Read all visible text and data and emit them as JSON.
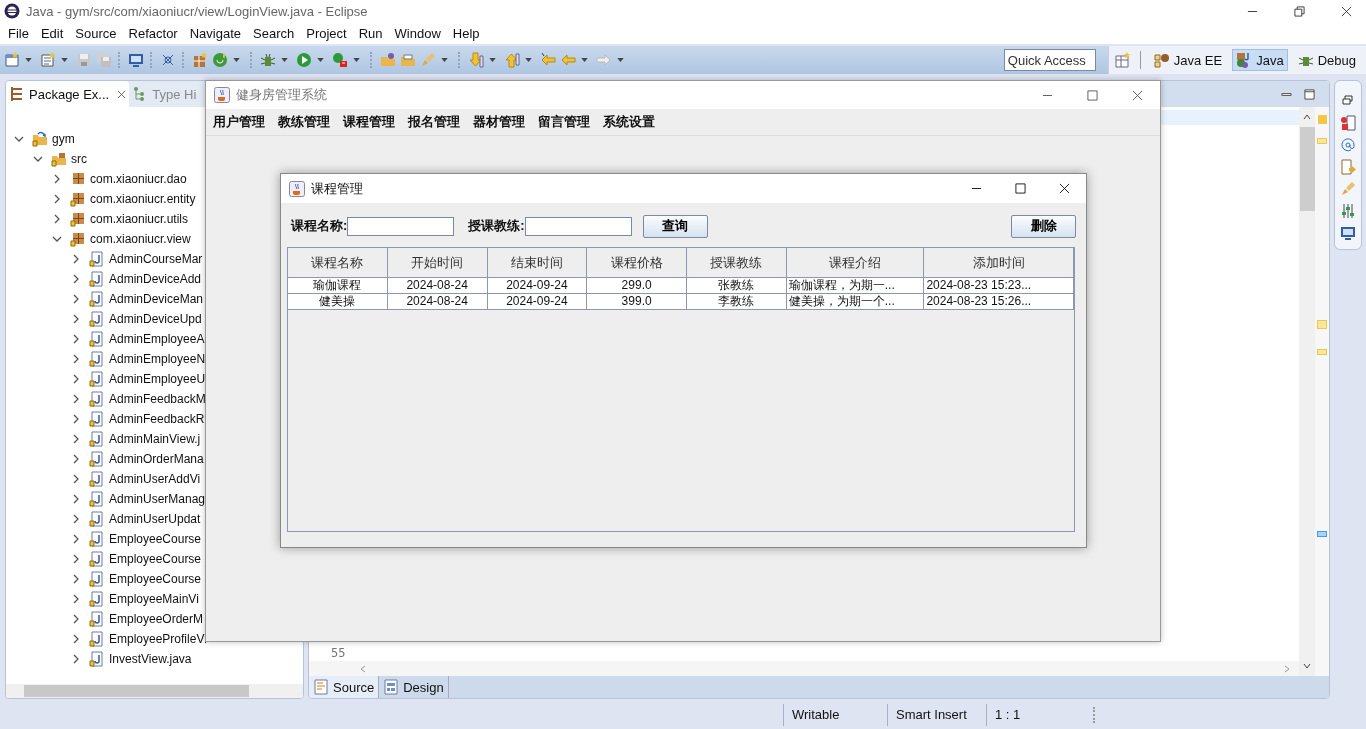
{
  "window": {
    "title": "Java - gym/src/com/xiaoniucr/view/LoginView.java - Eclipse"
  },
  "menu": [
    "File",
    "Edit",
    "Source",
    "Refactor",
    "Navigate",
    "Search",
    "Project",
    "Run",
    "Window",
    "Help"
  ],
  "quick_access": {
    "placeholder": "Quick Access"
  },
  "perspectives": [
    {
      "label": "Java EE",
      "selected": false
    },
    {
      "label": "Java",
      "selected": true
    },
    {
      "label": "Debug",
      "selected": false
    }
  ],
  "package_explorer": {
    "tabs": [
      {
        "label": "Package Ex...",
        "selected": true
      },
      {
        "label": "Type Hi",
        "selected": false
      }
    ],
    "tree": [
      {
        "label": "gym",
        "kind": "project",
        "expanded": true,
        "children": [
          {
            "label": "src",
            "kind": "folder",
            "expanded": true,
            "children": [
              {
                "label": "com.xiaoniucr.dao",
                "kind": "package",
                "expanded": false
              },
              {
                "label": "com.xiaoniucr.entity",
                "kind": "package",
                "expanded": false
              },
              {
                "label": "com.xiaoniucr.utils",
                "kind": "package",
                "expanded": false
              },
              {
                "label": "com.xiaoniucr.view",
                "kind": "package",
                "expanded": true,
                "children": [
                  {
                    "label": "AdminCourseMar",
                    "kind": "file",
                    "expanded": false
                  },
                  {
                    "label": "AdminDeviceAdd",
                    "kind": "file",
                    "expanded": false
                  },
                  {
                    "label": "AdminDeviceMan",
                    "kind": "file",
                    "expanded": false
                  },
                  {
                    "label": "AdminDeviceUpd",
                    "kind": "file",
                    "expanded": false
                  },
                  {
                    "label": "AdminEmployeeA",
                    "kind": "file",
                    "expanded": false
                  },
                  {
                    "label": "AdminEmployeeN",
                    "kind": "file",
                    "expanded": false
                  },
                  {
                    "label": "AdminEmployeeU",
                    "kind": "file",
                    "expanded": false
                  },
                  {
                    "label": "AdminFeedbackM",
                    "kind": "file",
                    "expanded": false
                  },
                  {
                    "label": "AdminFeedbackR",
                    "kind": "file",
                    "expanded": false
                  },
                  {
                    "label": "AdminMainView.j",
                    "kind": "file",
                    "expanded": false
                  },
                  {
                    "label": "AdminOrderMana",
                    "kind": "file",
                    "expanded": false
                  },
                  {
                    "label": "AdminUserAddVi",
                    "kind": "file",
                    "expanded": false
                  },
                  {
                    "label": "AdminUserManag",
                    "kind": "file",
                    "expanded": false
                  },
                  {
                    "label": "AdminUserUpdat",
                    "kind": "file",
                    "expanded": false
                  },
                  {
                    "label": "EmployeeCourse",
                    "kind": "file",
                    "expanded": false
                  },
                  {
                    "label": "EmployeeCourse",
                    "kind": "file",
                    "expanded": false
                  },
                  {
                    "label": "EmployeeCourse",
                    "kind": "file",
                    "expanded": false
                  },
                  {
                    "label": "EmployeeMainVi",
                    "kind": "file",
                    "expanded": false
                  },
                  {
                    "label": "EmployeeOrderM",
                    "kind": "file",
                    "expanded": false
                  },
                  {
                    "label": "EmployeeProfileVi",
                    "kind": "file",
                    "expanded": false
                  },
                  {
                    "label": "InvestView.java",
                    "kind": "file",
                    "expanded": false
                  }
                ]
              }
            ]
          }
        ]
      }
    ]
  },
  "editor": {
    "line_numbers": [
      "55"
    ],
    "tabs": [
      {
        "label": "Source",
        "selected": true
      },
      {
        "label": "Design",
        "selected": false
      }
    ]
  },
  "status_bar": [
    "Writable",
    "Smart Insert",
    "1 : 1"
  ],
  "app_frame": {
    "title": "健身房管理系统",
    "menu": [
      "用户管理",
      "教练管理",
      "课程管理",
      "报名管理",
      "器材管理",
      "留言管理",
      "系统设置"
    ]
  },
  "dialog": {
    "title": "课程管理",
    "fields": [
      "课程名称:",
      "授课教练:"
    ],
    "search_button": "查询",
    "delete_button": "删除",
    "table": {
      "columns": [
        "课程名称",
        "开始时间",
        "结束时间",
        "课程价格",
        "授课教练",
        "课程介绍",
        "添加时间"
      ],
      "rows": [
        [
          "瑜伽课程",
          "2024-08-24",
          "2024-09-24",
          "299.0",
          "张教练",
          "瑜伽课程，为期一...",
          "2024-08-23 15:23..."
        ],
        [
          "健美操",
          "2024-08-24",
          "2024-09-24",
          "399.0",
          "李教练",
          "健美操，为期一个...",
          "2024-08-23 15:26..."
        ]
      ]
    }
  }
}
